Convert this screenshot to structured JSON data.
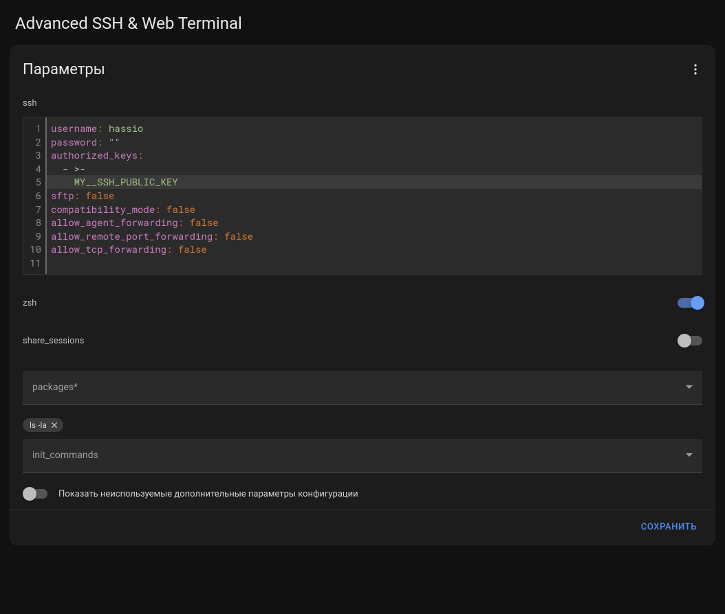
{
  "header": {
    "title": "Advanced SSH & Web Terminal"
  },
  "card": {
    "title": "Параметры",
    "ssh_label": "ssh",
    "yaml_lines": [
      {
        "n": 1,
        "segments": [
          {
            "t": "username",
            "c": "key"
          },
          {
            "t": ":",
            "c": "punc"
          },
          {
            "t": " ",
            "c": "plain"
          },
          {
            "t": "hassio",
            "c": "str"
          }
        ]
      },
      {
        "n": 2,
        "segments": [
          {
            "t": "password",
            "c": "key"
          },
          {
            "t": ":",
            "c": "punc"
          },
          {
            "t": " ",
            "c": "plain"
          },
          {
            "t": "\"\"",
            "c": "str"
          }
        ]
      },
      {
        "n": 3,
        "segments": [
          {
            "t": "authorized_keys",
            "c": "key"
          },
          {
            "t": ":",
            "c": "punc"
          }
        ]
      },
      {
        "n": 4,
        "segments": [
          {
            "t": "  ",
            "c": "plain"
          },
          {
            "t": "- >-",
            "c": "seq"
          }
        ]
      },
      {
        "n": 5,
        "active": true,
        "segments": [
          {
            "t": "    ",
            "c": "plain"
          },
          {
            "t": "MY__SSH_PUBLIC_KEY",
            "c": "str"
          }
        ]
      },
      {
        "n": 6,
        "segments": [
          {
            "t": "sftp",
            "c": "key"
          },
          {
            "t": ":",
            "c": "punc"
          },
          {
            "t": " ",
            "c": "plain"
          },
          {
            "t": "false",
            "c": "bool"
          }
        ]
      },
      {
        "n": 7,
        "segments": [
          {
            "t": "compatibility_mode",
            "c": "key"
          },
          {
            "t": ":",
            "c": "punc"
          },
          {
            "t": " ",
            "c": "plain"
          },
          {
            "t": "false",
            "c": "bool"
          }
        ]
      },
      {
        "n": 8,
        "segments": [
          {
            "t": "allow_agent_forwarding",
            "c": "key"
          },
          {
            "t": ":",
            "c": "punc"
          },
          {
            "t": " ",
            "c": "plain"
          },
          {
            "t": "false",
            "c": "bool"
          }
        ]
      },
      {
        "n": 9,
        "segments": [
          {
            "t": "allow_remote_port_forwarding",
            "c": "key"
          },
          {
            "t": ":",
            "c": "punc"
          },
          {
            "t": " ",
            "c": "plain"
          },
          {
            "t": "false",
            "c": "bool"
          }
        ]
      },
      {
        "n": 10,
        "segments": [
          {
            "t": "allow_tcp_forwarding",
            "c": "key"
          },
          {
            "t": ":",
            "c": "punc"
          },
          {
            "t": " ",
            "c": "plain"
          },
          {
            "t": "false",
            "c": "bool"
          }
        ]
      },
      {
        "n": 11,
        "segments": []
      }
    ],
    "toggles": {
      "zsh": {
        "label": "zsh",
        "value": true
      },
      "share_sessions": {
        "label": "share_sessions",
        "value": false
      },
      "show_unused": {
        "label": "Показать неиспользуемые дополнительные параметры конфигурации",
        "value": false
      }
    },
    "packages_field": {
      "label": "packages*"
    },
    "init_commands": {
      "chips": [
        "ls -la"
      ],
      "label": "init_commands"
    },
    "save_button": "СОХРАНИТЬ"
  }
}
